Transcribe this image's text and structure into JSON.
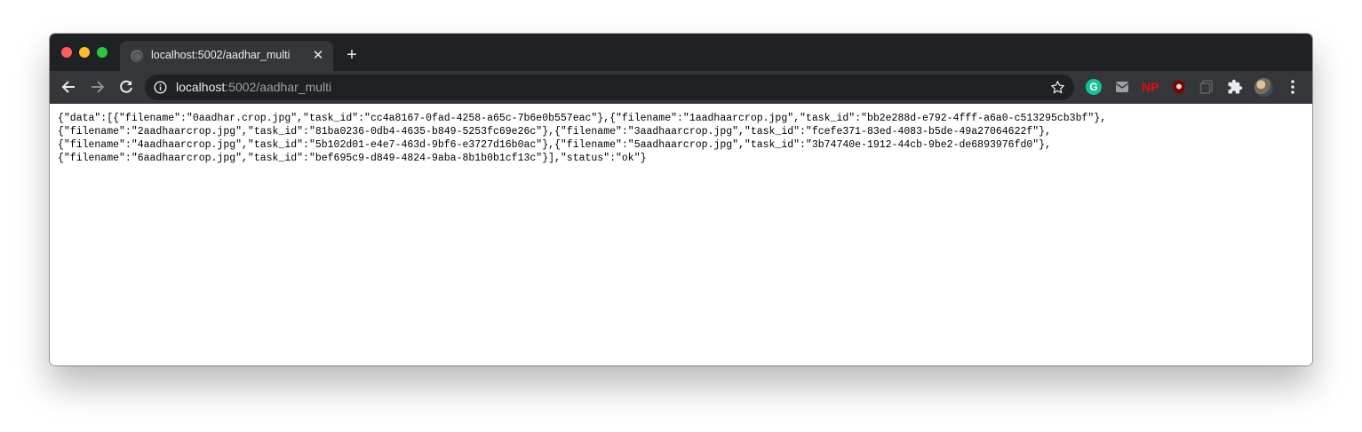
{
  "browser": {
    "tab": {
      "title": "localhost:5002/aadhar_multi",
      "close_symbol": "✕"
    },
    "new_tab_symbol": "+",
    "address": {
      "host": "localhost",
      "rest": ":5002/aadhar_multi"
    },
    "extensions": {
      "np_label": "NP"
    },
    "icons": [
      "back-icon",
      "forward-icon",
      "reload-icon",
      "info-icon",
      "star-icon",
      "grammarly-icon",
      "mail-icon",
      "np-icon",
      "ublock-icon",
      "copy-icon",
      "puzzle-icon",
      "avatar",
      "menu-icon"
    ]
  },
  "page": {
    "json_lines": [
      "{\"data\":[{\"filename\":\"0aadhar.crop.jpg\",\"task_id\":\"cc4a8167-0fad-4258-a65c-7b6e0b557eac\"},{\"filename\":\"1aadhaarcrop.jpg\",\"task_id\":\"bb2e288d-e792-4fff-a6a0-c513295cb3bf\"},",
      "{\"filename\":\"2aadhaarcrop.jpg\",\"task_id\":\"81ba0236-0db4-4635-b849-5253fc69e26c\"},{\"filename\":\"3aadhaarcrop.jpg\",\"task_id\":\"fcefe371-83ed-4083-b5de-49a27064622f\"},",
      "{\"filename\":\"4aadhaarcrop.jpg\",\"task_id\":\"5b102d01-e4e7-463d-9bf6-e3727d16b0ac\"},{\"filename\":\"5aadhaarcrop.jpg\",\"task_id\":\"3b74740e-1912-44cb-9be2-de6893976fd0\"},",
      "{\"filename\":\"6aadhaarcrop.jpg\",\"task_id\":\"bef695c9-d849-4824-9aba-8b1b0b1cf13c\"}],\"status\":\"ok\"}"
    ]
  },
  "colors": {
    "chrome_dark": "#202124",
    "chrome_toolbar": "#35363a",
    "traffic_close": "#ff5f57",
    "traffic_min": "#febc2e",
    "traffic_max": "#28c840"
  }
}
